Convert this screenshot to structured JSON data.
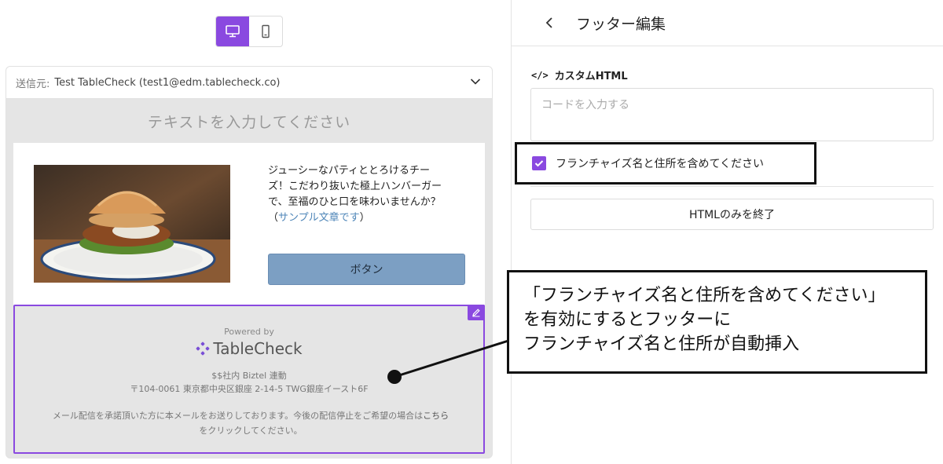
{
  "preview": {
    "device_toggle": {
      "desktop_icon": "desktop-monitor-icon",
      "mobile_icon": "mobile-phone-icon",
      "active": "desktop"
    },
    "sender": {
      "label": "送信元:",
      "value": "Test TableCheck (test1@edm.tablecheck.co)"
    },
    "email": {
      "header_text": "テキストを入力してください",
      "content": {
        "text_main": "ジューシーなパティととろけるチーズ！こだわり抜いた極上ハンバーガーで、至福のひと口を味わいませんか？（",
        "text_link": "サンプル文章です",
        "text_end": "）",
        "button_label": "ボタン"
      },
      "footer": {
        "powered_by": "Powered by",
        "logo_text": "TableCheck",
        "line1": "$$社内 Biztel 連動",
        "line2": "〒104-0061 東京都中央区銀座 2-14-5 TWG銀座イースト6F",
        "unsubscribe_text": "メール配信を承諾頂いた方に本メールをお送りしております。今後の配信停止をご希望の場合は",
        "unsubscribe_link": "こちら",
        "unsubscribe_end": "をクリックしてください。"
      }
    }
  },
  "panel": {
    "title": "フッター編集",
    "custom_html_label": "カスタムHTML",
    "code_input_placeholder": "コードを入力する",
    "checkbox_label": "フランチャイズ名と住所を含めてください",
    "checkbox_checked": true,
    "html_only_button": "HTMLのみを終了"
  },
  "callout": {
    "line1": "「フランチャイズ名と住所を含めてください」",
    "line2": "を有効にするとフッターに",
    "line3": "フランチャイズ名と住所が自動挿入"
  },
  "colors": {
    "accent": "#8a49e0",
    "button_blue": "#7c9fc3",
    "link_blue": "#4f86b8"
  }
}
